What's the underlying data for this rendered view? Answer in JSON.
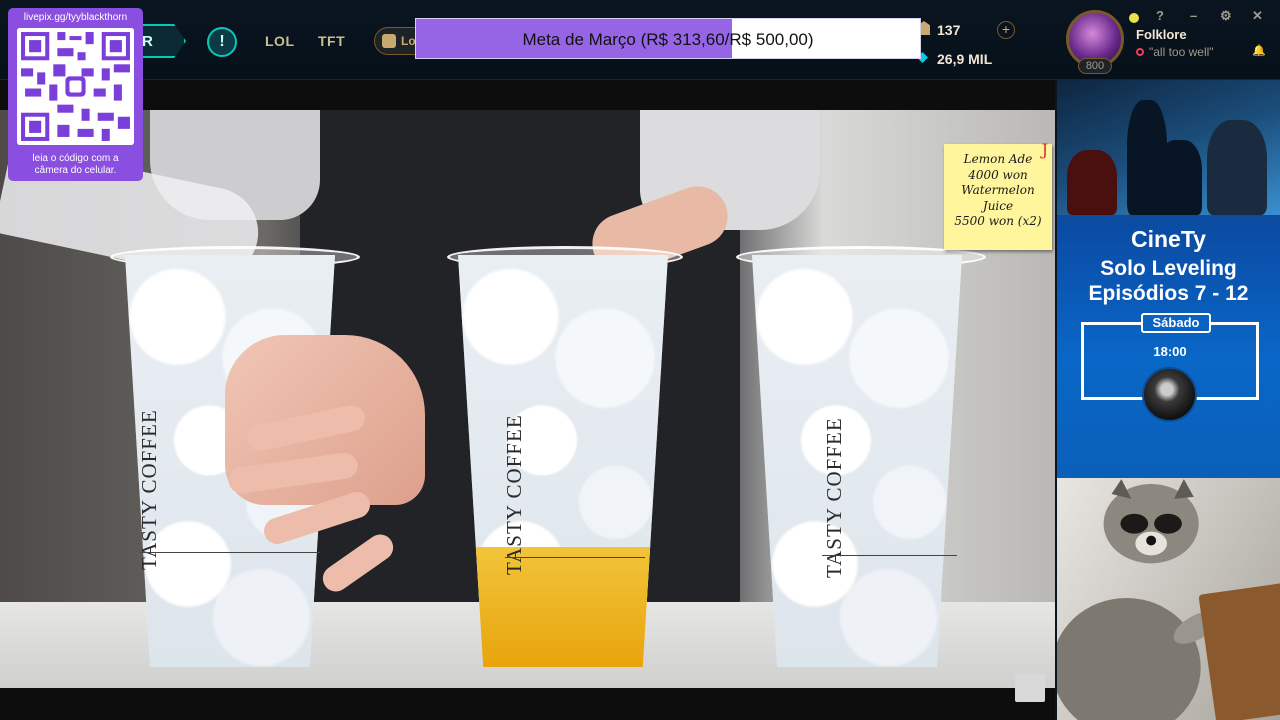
{
  "client": {
    "play_label": "R",
    "alert_label": "!",
    "nav": [
      "LOL",
      "TFT"
    ],
    "ranked_label": "Lo"
  },
  "donation_goal": {
    "text": "Meta de Março (R$ 313,60/R$ 500,00)",
    "current": 313.6,
    "target": 500.0,
    "fill_color": "#9565e6"
  },
  "currency": {
    "rp": "137",
    "blue_essence": "26,9 MIL",
    "plus_label": "+"
  },
  "profile": {
    "level": "800",
    "username": "Folklore",
    "status": "\"all too well\"",
    "help_label": "?",
    "minimize_label": "–",
    "settings_label": "⚙",
    "close_label": "✕",
    "bell_label": "🔔"
  },
  "video": {
    "cup_label": "TASTY COFFEE",
    "sticky_note": [
      "Lemon Ade",
      "4000 won",
      "Watermelon",
      "Juice",
      "5500 won (x2)"
    ],
    "sticky_mark": "J"
  },
  "qr_overlay": {
    "url": "livepix.gg/tyyblackthorn",
    "caption_line1": "leia o código com a",
    "caption_line2": "câmera do celular."
  },
  "promo": {
    "channel": "CineTy",
    "title_line1": "Solo Leveling",
    "title_line2": "Episódios 7 - 12",
    "day": "Sábado",
    "time": "18:00"
  }
}
